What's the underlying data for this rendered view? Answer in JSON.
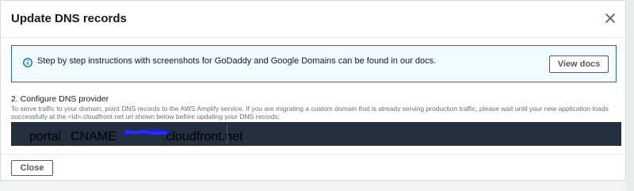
{
  "modal": {
    "title": "Update DNS records",
    "info": {
      "text": "Step by step instructions with screenshots for GoDaddy and Google Domains can be found in our docs.",
      "button_label": "View docs"
    },
    "section": {
      "title": "2. Configure DNS provider",
      "description": "To serve traffic to your domain, point DNS records to the AWS Amplify service. If you are migrating a custom domain that is already serving production traffic, please wait until your new application loads successfully at the <id>.cloudfront.net url shown below before updating your DNS records:"
    },
    "dns_record": {
      "name": "portal",
      "type": "CNAME",
      "value_suffix": ".cloudfront.net"
    },
    "close_label": "Close"
  },
  "colors": {
    "info_border": "#0073bb",
    "info_bg": "#f1faff",
    "code_bg": "#232f3e",
    "redaction": "#1a1aff"
  },
  "icons": [
    "close-icon",
    "info-icon"
  ]
}
